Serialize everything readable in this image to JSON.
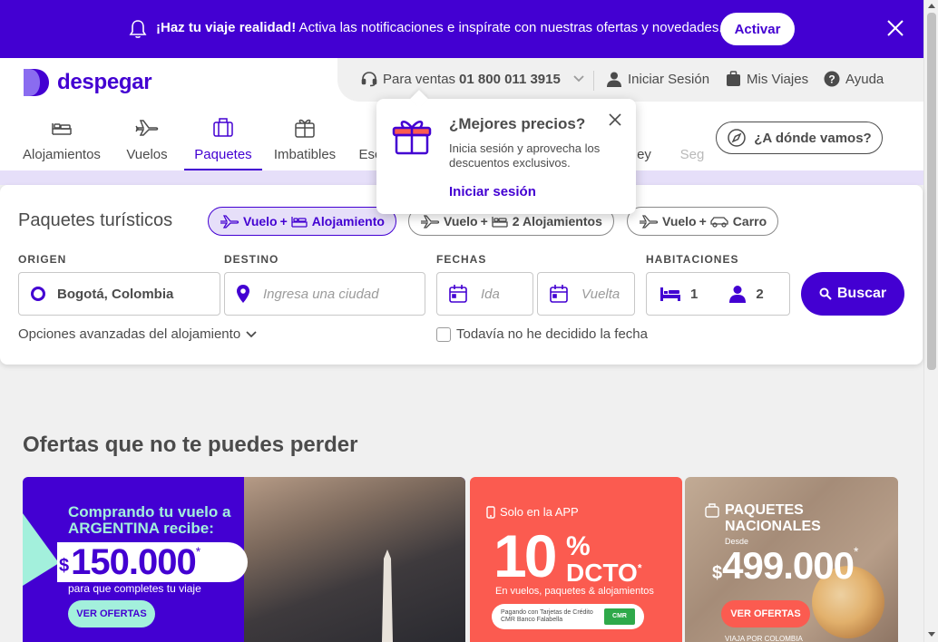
{
  "notification": {
    "bold": "¡Haz tu viaje realidad!",
    "text": " Activa las notificaciones e inspírate con nuestras ofertas y novedades.",
    "button": "Activar"
  },
  "brand": {
    "name": "despegar",
    "color": "#4300d2"
  },
  "topbar": {
    "sales_label": "Para ventas",
    "sales_phone": "01 800 011 3915",
    "login": "Iniciar Sesión",
    "trips": "Mis Viajes",
    "help": "Ayuda"
  },
  "nav": {
    "items": [
      {
        "label": "Alojamientos",
        "icon": "bed-icon"
      },
      {
        "label": "Vuelos",
        "icon": "plane-icon"
      },
      {
        "label": "Paquetes",
        "icon": "suitcase-icon"
      },
      {
        "label": "Imbatibles",
        "icon": "gift-box-icon"
      },
      {
        "label": "Esc",
        "icon": ""
      },
      {
        "label": "ey",
        "icon": ""
      },
      {
        "label": "Seg",
        "icon": ""
      }
    ],
    "destination_button": "¿A dónde vamos?"
  },
  "tooltip": {
    "title": "¿Mejores precios?",
    "body": "Inicia sesión y aprovecha los descuentos exclusivos.",
    "link": "Iniciar sesión"
  },
  "search": {
    "title": "Paquetes turísticos",
    "chips": [
      {
        "a": "Vuelo",
        "b": "Alojamiento"
      },
      {
        "a": "Vuelo",
        "b": "2 Alojamientos"
      },
      {
        "a": "Vuelo",
        "b": "Carro"
      }
    ],
    "labels": {
      "origin": "ORIGEN",
      "destination": "DESTINO",
      "dates": "FECHAS",
      "rooms": "HABITACIONES"
    },
    "origin_value": "Bogotá, Colombia",
    "destination_placeholder": "Ingresa una ciudad",
    "ida_placeholder": "Ida",
    "vuelta_placeholder": "Vuelta",
    "rooms": "1",
    "people": "2",
    "button": "Buscar",
    "advanced": "Opciones avanzadas del alojamiento",
    "no_date": "Todavía no he decidido la fecha"
  },
  "offers": {
    "title": "Ofertas que no te puedes perder",
    "banner1": {
      "line1": "Comprando tu vuelo a",
      "line2": "ARGENTINA recibe:",
      "currency": "$",
      "amount": "150.000",
      "asterisk": "*",
      "sub": "para que completes tu viaje",
      "button": "VER OFERTAS"
    },
    "banner2": {
      "app": "Solo en la APP",
      "big": "10",
      "pct": "%",
      "dcto": "DCTO",
      "asterisk": "*",
      "sub": "En vuelos, paquetes & alojamientos",
      "pay": "Pagando con Tarjetas de Crédito CMR Banco Falabella",
      "cmr": "CMR"
    },
    "banner3": {
      "line1": "PAQUETES",
      "line2": "NACIONALES",
      "desde": "Desde",
      "currency": "$",
      "amount": "499.000",
      "asterisk": "*",
      "button": "VER OFERTAS",
      "foot": "VIAJA POR COLOMBIA"
    }
  }
}
